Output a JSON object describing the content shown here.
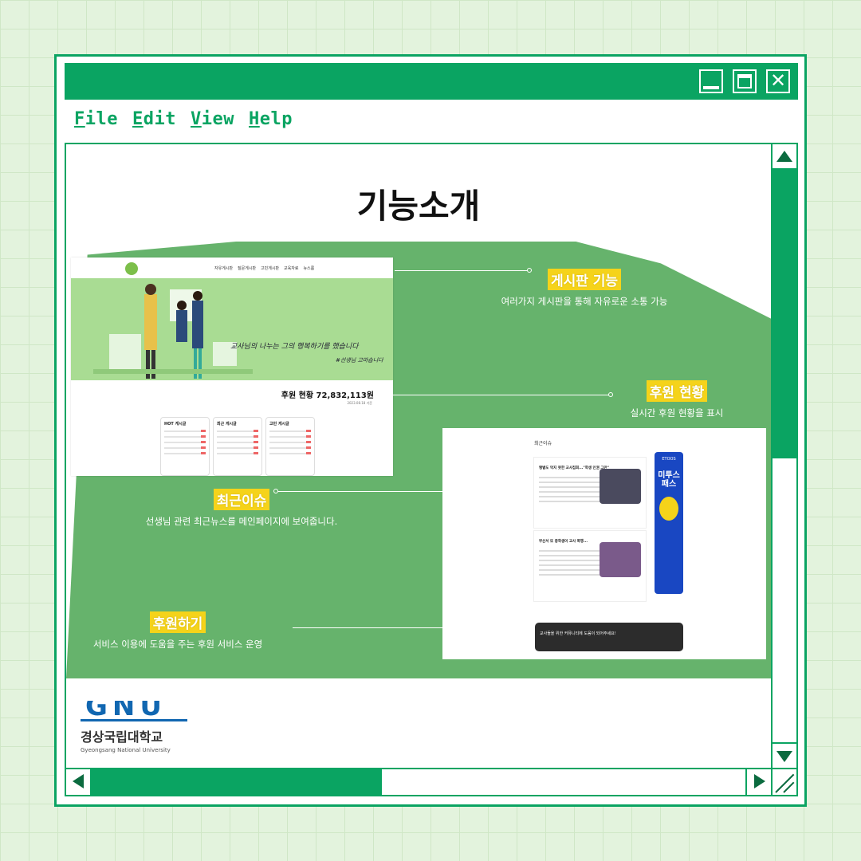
{
  "window": {
    "menu": [
      {
        "label": "File",
        "accel": "F",
        "rest": "ile"
      },
      {
        "label": "Edit",
        "accel": "E",
        "rest": "dit"
      },
      {
        "label": "View",
        "accel": "V",
        "rest": "iew"
      },
      {
        "label": "Help",
        "accel": "H",
        "rest": "elp"
      }
    ],
    "close_glyph": "✕"
  },
  "colors": {
    "accent": "#0aa462",
    "panel_green": "#66b36c",
    "highlight": "#f5d31a",
    "background": "#e3f3dd"
  },
  "page": {
    "title": "기능소개",
    "callouts": {
      "board": {
        "tag": "게시판 기능",
        "desc": "여러가지 게시판을 통해 자유로운 소통 가능"
      },
      "donation_status": {
        "tag": "후원 현황",
        "desc": "실시간 후원 현황을 표시"
      },
      "recent_issue": {
        "tag": "최근이슈",
        "desc": "선생님 관련 최근뉴스를 메인페이지에 보여줍니다."
      },
      "donate": {
        "tag": "후원하기",
        "desc": "서비스 이용에 도움을 주는 후원 서비스 운영"
      }
    }
  },
  "screenshot_main": {
    "nav_links": [
      "자유게시판",
      "질문게시판",
      "고민게시판",
      "교육자료",
      "뉴스룸"
    ],
    "slogan": "교사님의 나누는 그의 행복하기를 했습니다",
    "slogan2": "#선생님 고마습니다",
    "donation_text": "후원 현황  72,832,113원",
    "donation_date": "2023.08.18 기준",
    "boards": [
      "HOT 게시글",
      "최근 게시글",
      "고민 게시글"
    ]
  },
  "screenshot_news": {
    "section_title": "최근이슈",
    "news": [
      {
        "title": "땡볕도 막지 못한 교사집회...\"학생 인권 그만\""
      },
      {
        "title": "부산서 또 중학생이 교사 폭행..."
      }
    ],
    "ad": {
      "brand": "ETOOS",
      "headline": "미투스 패스"
    },
    "banner_text": "교사들을 위한 커뮤니티에 도움이 되어주세요!"
  },
  "footer_logo": {
    "mark": "GNU",
    "korean": "경상국립대학교",
    "english": "Gyeongsang National University"
  }
}
